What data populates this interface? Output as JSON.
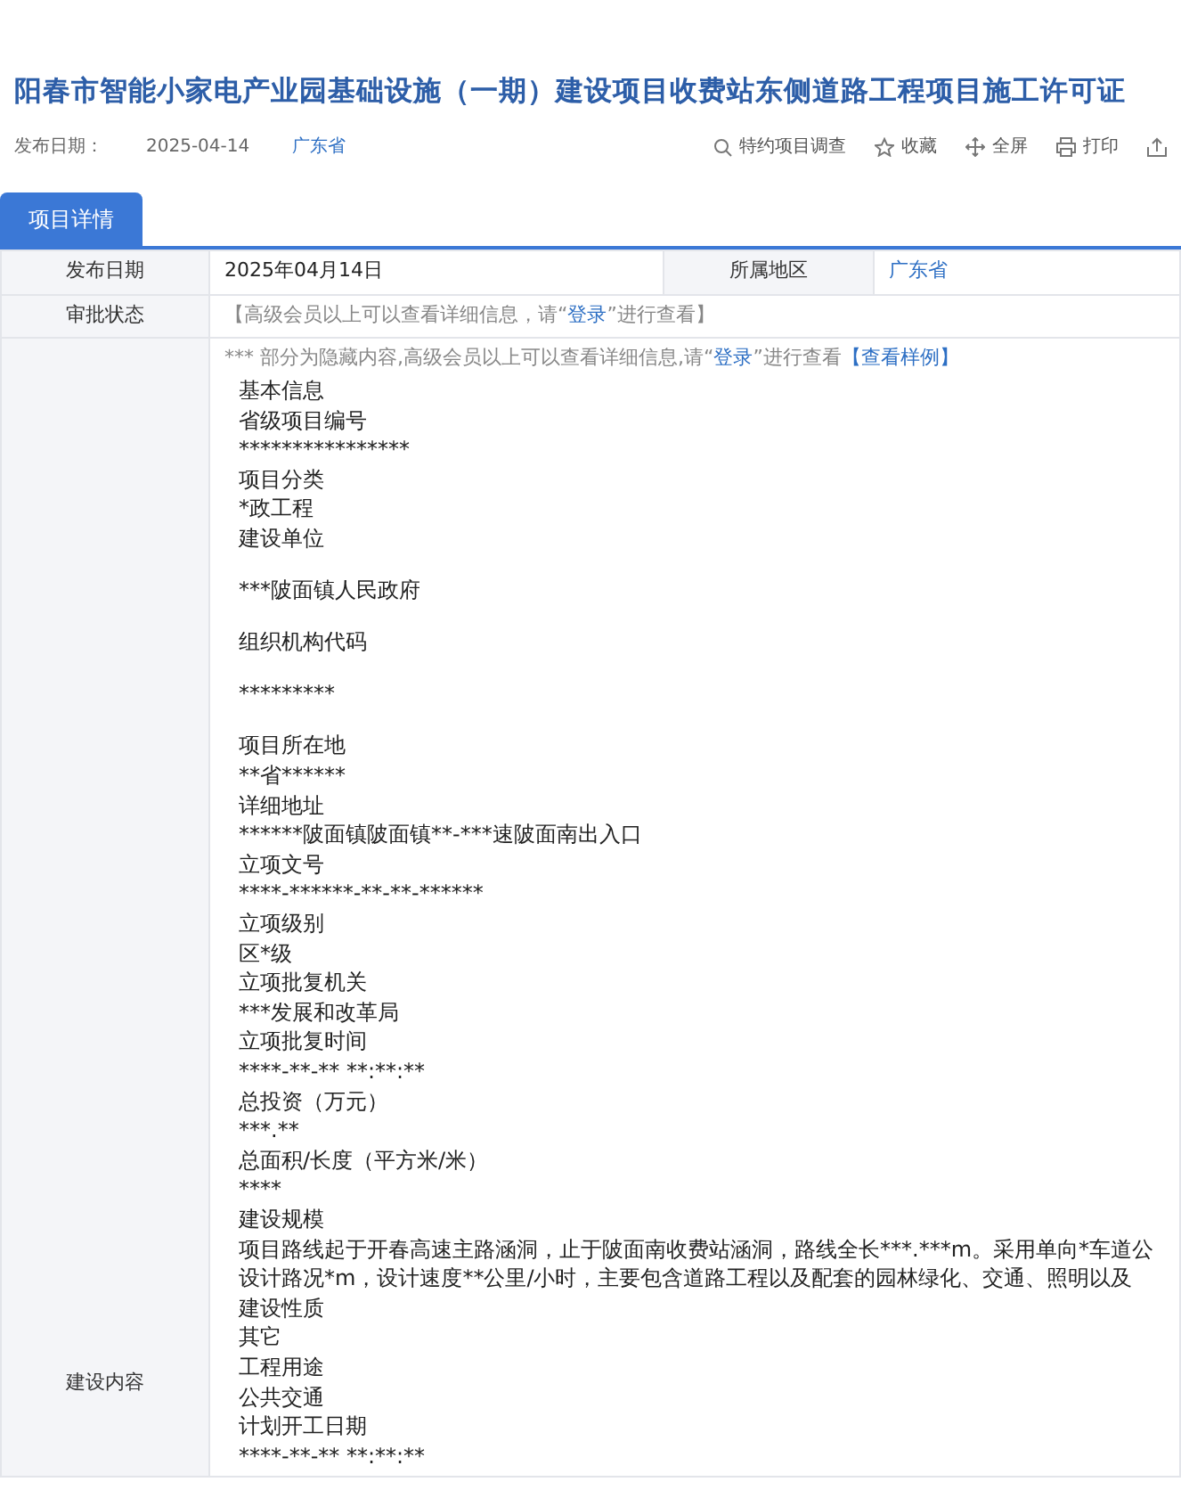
{
  "title": "阳春市智能小家电产业园基础设施（一期）建设项目收费站东侧道路工程项目施工许可证",
  "meta": {
    "date_label": "发布日期：",
    "date": "2025-04-14",
    "region": "广东省"
  },
  "actions": [
    {
      "kind": "search",
      "label": "特约项目调查"
    },
    {
      "kind": "star",
      "label": "收藏"
    },
    {
      "kind": "fullscreen",
      "label": "全屏"
    },
    {
      "kind": "print",
      "label": "打印"
    },
    {
      "kind": "export"
    }
  ],
  "tabs": [
    {
      "label": "项目详情",
      "selected": true
    }
  ],
  "table": {
    "row_1": {
      "label": "发布日期",
      "value": "2025年04月14日",
      "label_2": "所属地区",
      "value_2": "广东省"
    },
    "row_2": {
      "label": "审批状态",
      "before": "【高级会员以上可以查看详细信息，请“",
      "link": "登录",
      "after": "”进行查看】"
    },
    "row_3": {
      "label": "建设内容",
      "notice": {
        "before": "*** 部分为隐藏内容,高级会员以上可以查看详细信息,请“",
        "link": "登录",
        "after": "”进行查看",
        "sample_link": "【查看样例】"
      },
      "lines": [
        {
          "kind": "line",
          "text": "基本信息"
        },
        {
          "kind": "line",
          "text": "省级项目编号"
        },
        {
          "kind": "line",
          "text": "****************"
        },
        {
          "kind": "line",
          "text": "项目分类"
        },
        {
          "kind": "line",
          "text": "*政工程"
        },
        {
          "kind": "line",
          "text": "建设单位"
        },
        {
          "kind": "paragraph",
          "text": "***陂面镇人民政府"
        },
        {
          "kind": "line",
          "text": "组织机构代码"
        },
        {
          "kind": "paragraph",
          "text": "*********"
        },
        {
          "kind": "line",
          "text": "项目所在地"
        },
        {
          "kind": "line",
          "text": "**省******"
        },
        {
          "kind": "line",
          "text": "详细地址"
        },
        {
          "kind": "line",
          "text": "******陂面镇陂面镇**-***速陂面南出入口"
        },
        {
          "kind": "line",
          "text": "立项文号"
        },
        {
          "kind": "line",
          "text": "****-******-**-**-******"
        },
        {
          "kind": "line",
          "text": "立项级别"
        },
        {
          "kind": "line",
          "text": "区*级"
        },
        {
          "kind": "line",
          "text": "立项批复机关"
        },
        {
          "kind": "line",
          "text": "***发展和改革局"
        },
        {
          "kind": "line",
          "text": "立项批复时间"
        },
        {
          "kind": "line",
          "text": "****-**-** **:**:**"
        },
        {
          "kind": "line",
          "text": "总投资（万元）"
        },
        {
          "kind": "line",
          "text": "***.**"
        },
        {
          "kind": "line",
          "text": "总面积/长度（平方米/米）"
        },
        {
          "kind": "line",
          "text": "****"
        },
        {
          "kind": "line",
          "text": "建设规模"
        },
        {
          "kind": "line",
          "text": "项目路线起于开春高速主路涵洞，止于陂面南收费站涵洞，路线全长***.***m。采用单向*车道公"
        },
        {
          "kind": "line",
          "text": "设计路况*m，设计速度**公里/小时，主要包含道路工程以及配套的园林绿化、交通、照明以及"
        },
        {
          "kind": "line",
          "text": "建设性质"
        },
        {
          "kind": "line",
          "text": "其它"
        },
        {
          "kind": "line",
          "text": "工程用途"
        },
        {
          "kind": "line",
          "text": "公共交通"
        },
        {
          "kind": "line",
          "text": "计划开工日期"
        },
        {
          "kind": "line",
          "text": "****-**-** **:**:**"
        }
      ]
    }
  }
}
